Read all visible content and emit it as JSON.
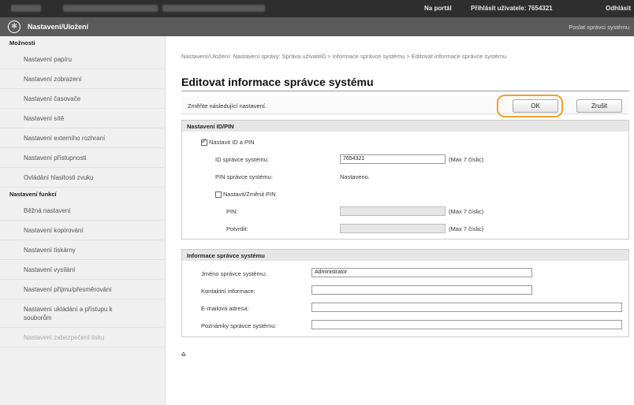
{
  "topbar": {
    "portal": "Na portál",
    "login_user": "Přihlásit uživatele: 7654321",
    "logout": "Odhlásit"
  },
  "header": {
    "title": "Nastavení/Uložení",
    "mail_admin": "Poslat správci systému"
  },
  "sidebar": {
    "section1": "Možnosti",
    "items1": [
      "Nastavení papíru",
      "Nastavení zobrazení",
      "Nastavení časovače",
      "Nastavení sítě",
      "Nastavení externího rozhraní",
      "Nastavení přístupnosti",
      "Ovládání hlasitosti zvuku"
    ],
    "section2": "Nastavení funkcí",
    "items2": [
      "Běžná nastavení",
      "Nastavení kopírování",
      "Nastavení tiskárny",
      "Nastavení vysílání",
      "Nastavení příjmu/přesměrování",
      "Nastavení ukládání a přístupu k souborům",
      "Nastavení zabezpečení tisku"
    ]
  },
  "main": {
    "breadcrumb": "Nastavení/Uložení: Nastavení správy: Správa uživatelů > Informace správce systému > Editovat informace správce systému",
    "page_title": "Editovat informace správce systému",
    "intro": "Změňte následující nastavení.",
    "ok_label": "OK",
    "cancel_label": "Zrušit",
    "idpin": {
      "header": "Nastavení ID/PIN",
      "set_id_pin": "Nastavit ID a PIN",
      "set_id_pin_checked": true,
      "admin_id_label": "ID správce systému:",
      "admin_id_value": "7654321",
      "max7": "(Max 7 číslic)",
      "admin_pin_label": "PIN správce systému:",
      "admin_pin_value": "Nastaveno.",
      "change_pin": "Nastavit/Změnit PIN",
      "change_pin_checked": false,
      "pin_label": "PIN:",
      "confirm_label": "Potvrdit:"
    },
    "admininfo": {
      "header": "Informace správce systému",
      "name_label": "Jméno správce systému:",
      "name_value": "Administrator",
      "contact_label": "Kontaktní informace:",
      "email_label": "E-mailová adresa:",
      "notes_label": "Poznámky správce systému:"
    },
    "to_top": "⩠"
  }
}
